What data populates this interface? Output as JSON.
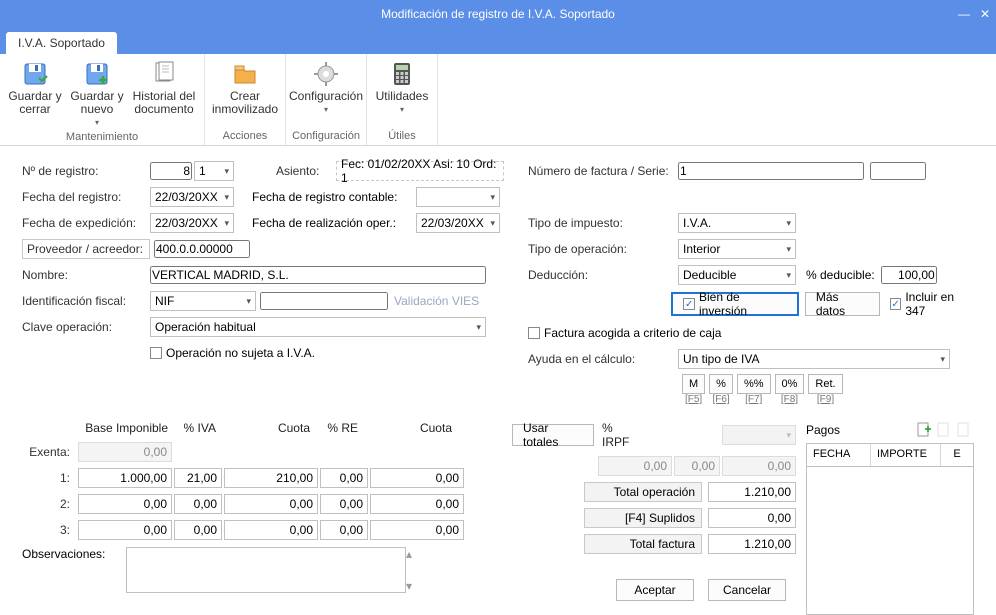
{
  "window": {
    "title": "Modificación de registro de I.V.A. Soportado"
  },
  "tab": {
    "label": "I.V.A. Soportado"
  },
  "ribbon": {
    "save_close": "Guardar y cerrar",
    "save_new": "Guardar y nuevo",
    "doc_history": "Historial del documento",
    "group_maint": "Mantenimiento",
    "create_asset": "Crear inmovilizado",
    "group_actions": "Acciones",
    "config": "Configuración",
    "group_config": "Configuración",
    "utilities": "Utilidades",
    "group_utils": "Útiles"
  },
  "left": {
    "num_reg_label": "Nº de registro:",
    "num_reg": "8",
    "num_reg_sub": "1",
    "asiento_label": "Asiento:",
    "asiento": "Fec: 01/02/20XX Asi: 10 Ord: 1",
    "fecha_reg_label": "Fecha del registro:",
    "fecha_reg": "22/03/20XX",
    "fecha_reg_cont_label": "Fecha de registro contable:",
    "fecha_exp_label": "Fecha de expedición:",
    "fecha_exp": "22/03/20XX",
    "fecha_real_label": "Fecha de realización oper.:",
    "fecha_real": "22/03/20XX",
    "proveedor_label": "Proveedor / acreedor:",
    "proveedor": "400.0.0.00000",
    "nombre_label": "Nombre:",
    "nombre": "VERTICAL MADRID, S.L.",
    "id_fiscal_label": "Identificación fiscal:",
    "id_fiscal_type": "NIF",
    "id_fiscal_value": "",
    "validacion_vies": "Validación VIES",
    "clave_op_label": "Clave operación:",
    "clave_op": "Operación habitual",
    "no_sujeta": "Operación no sujeta a I.V.A."
  },
  "right": {
    "num_fact_label": "Número de factura / Serie:",
    "num_fact": "1",
    "num_fact_serie": "",
    "tipo_imp_label": "Tipo de impuesto:",
    "tipo_imp": "I.V.A.",
    "tipo_op_label": "Tipo de operación:",
    "tipo_op": "Interior",
    "deduccion_label": "Deducción:",
    "deduccion": "Deducible",
    "pct_deducible_label": "% deducible:",
    "pct_deducible": "100,00",
    "bien_inversion": "Bien de inversión",
    "mas_datos": "Más datos",
    "incluir_347": "Incluir en 347",
    "fact_criterio_caja": "Factura acogida a criterio de caja",
    "ayuda_label": "Ayuda en el cálculo:",
    "ayuda": "Un tipo de IVA",
    "btn_m": "M",
    "btn_pct": "%",
    "btn_pctpct": "%%",
    "btn_0pct": "0%",
    "btn_ret": "Ret.",
    "f5": "[F5]",
    "f6": "[F6]",
    "f7": "[F7]",
    "f8": "[F8]",
    "f9": "[F9]"
  },
  "grid": {
    "h_base": "Base Imponible",
    "h_pctiva": "% IVA",
    "h_cuota": "Cuota",
    "h_pctre": "% RE",
    "h_cuota2": "Cuota",
    "usar_totales": "Usar totales",
    "h_pctirpf": "% IRPF",
    "r_exenta": "Exenta:",
    "r1": "1:",
    "r2": "2:",
    "r3": "3:",
    "exenta_base": "0,00",
    "row1": {
      "base": "1.000,00",
      "pctiva": "21,00",
      "cuota": "210,00",
      "pctre": "0,00",
      "cuota2": "0,00"
    },
    "row2": {
      "base": "0,00",
      "pctiva": "0,00",
      "cuota": "0,00",
      "pctre": "0,00",
      "cuota2": "0,00"
    },
    "row3": {
      "base": "0,00",
      "pctiva": "0,00",
      "cuota": "0,00",
      "pctre": "0,00",
      "cuota2": "0,00"
    },
    "irpf_base": "0,00",
    "irpf_pct": "0,00",
    "irpf_cuota": "0,00",
    "total_op_label": "Total operación",
    "total_op": "1.210,00",
    "suplidos_label": "[F4] Suplidos",
    "suplidos": "0,00",
    "total_fact_label": "Total factura",
    "total_fact": "1.210,00",
    "obs_label": "Observaciones:"
  },
  "pagos": {
    "title": "Pagos",
    "fecha": "FECHA",
    "importe": "IMPORTE",
    "e": "E"
  },
  "footer": {
    "aceptar": "Aceptar",
    "cancelar": "Cancelar"
  }
}
